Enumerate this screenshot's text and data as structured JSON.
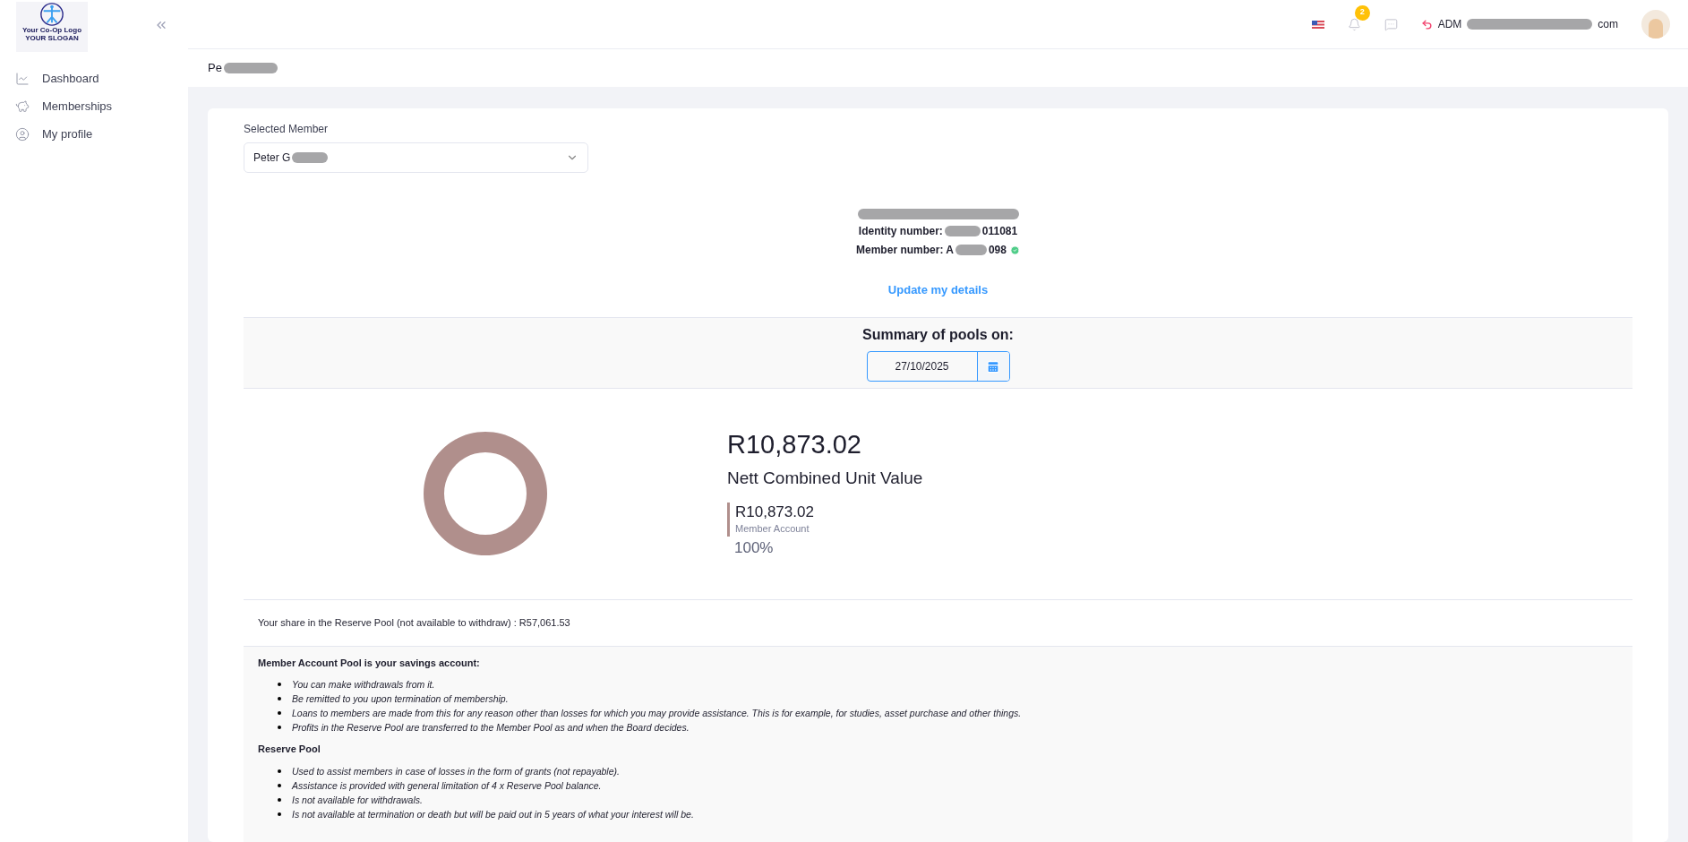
{
  "logo": {
    "title": "Your Co-Op Logo",
    "slogan": "YOUR SLOGAN"
  },
  "sidebar": {
    "items": [
      {
        "label": "Dashboard",
        "selected": false
      },
      {
        "label": "Memberships",
        "selected": false
      },
      {
        "label": "My profile",
        "selected": false
      }
    ]
  },
  "header": {
    "notifications": "2",
    "user_prefix": "ADM",
    "user_suffix": "com"
  },
  "breadcrumb": "Pe",
  "member_select": {
    "label": "Selected Member",
    "value": "Peter G"
  },
  "member": {
    "identity_label": "Identity number:",
    "identity_tail": "011081",
    "member_label": "Member number: A",
    "member_tail": "098",
    "verified": true,
    "update_link": "Update my details"
  },
  "summary": {
    "title": "Summary of pools on:",
    "date": "27/10/2025"
  },
  "total": {
    "amount": "R10,873.02",
    "label": "Nett Combined Unit Value"
  },
  "pools": [
    {
      "amount": "R10,873.02",
      "name": "Member Account",
      "share": "100%",
      "color": "#b08f8c"
    }
  ],
  "reserve_line": "Your share in the Reserve Pool (not available to withdraw) : R57,061.53",
  "info": [
    {
      "heading": "Member Account Pool is your savings account:",
      "items": [
        "You can make withdrawals from it.",
        "Be remitted to you upon termination of membership.",
        "Loans to members are made from this for any reason other than losses for which you may provide assistance. This is for example, for studies, asset purchase and other things.",
        "Profits in the Reserve Pool are transferred to the Member Pool as and when the Board decides."
      ]
    },
    {
      "heading": "Reserve Pool",
      "items": [
        "Used to assist members in case of losses in the form of grants (not repayable).",
        "Assistance is provided with general limitation of 4 x Reserve Pool balance.",
        "Is not available for withdrawals.",
        "Is not available at termination or death but will be paid out in 5 years of what your interest will be."
      ]
    }
  ]
}
